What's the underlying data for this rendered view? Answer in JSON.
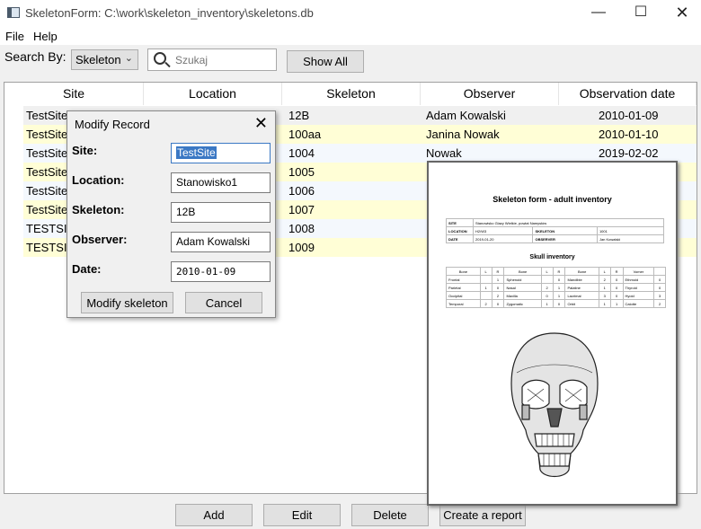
{
  "window": {
    "title": "SkeletonForm: C:\\work\\skeleton_inventory\\skeletons.db"
  },
  "menu": [
    "File",
    "Help"
  ],
  "search": {
    "label": "Search By:",
    "by_value": "Skeleton",
    "placeholder": "Szukaj",
    "show_all_label": "Show All"
  },
  "table": {
    "columns": [
      "Site",
      "Location",
      "Skeleton",
      "Observer",
      "Observation date"
    ],
    "rows": [
      {
        "site": "TestSite",
        "skeleton": "12B",
        "observer": "Adam Kowalski",
        "date": "2010-01-09"
      },
      {
        "site": "TestSite",
        "skeleton": "100aa",
        "observer": "Janina Nowak",
        "date": "2010-01-10"
      },
      {
        "site": "TestSite4",
        "skeleton": "1004",
        "observer": "Nowak",
        "date": "2019-02-02"
      },
      {
        "site": "TestSite5",
        "skeleton": "1005",
        "observer": "",
        "date": ""
      },
      {
        "site": "TestSite5",
        "skeleton": "1006",
        "observer": "",
        "date": ""
      },
      {
        "site": "TestSite5",
        "skeleton": "1007",
        "observer": "",
        "date": ""
      },
      {
        "site": "TESTSITE",
        "skeleton": "1008",
        "observer": "",
        "date": ""
      },
      {
        "site": "TESTSITE",
        "skeleton": "1009",
        "observer": "",
        "date": ""
      }
    ]
  },
  "dialog": {
    "title": "Modify Record",
    "site_label": "Site:",
    "site_value": "TestSite",
    "location_label": "Location:",
    "location_value": "Stanowisko1",
    "skeleton_label": "Skeleton:",
    "skeleton_value": "12B",
    "observer_label": "Observer:",
    "observer_value": "Adam Kowalski",
    "date_label": "Date:",
    "date_value": "2010-01-09",
    "modify_label": "Modify skeleton",
    "cancel_label": "Cancel"
  },
  "report": {
    "title": "Skeleton form - adult inventory",
    "site_label": "SITE",
    "site_value": "Stanowisko Glazy Wielkie, powiat Namysłów",
    "location_label": "LOCATION",
    "location_value": "H2/W3",
    "skeleton_label": "SKELETON",
    "skeleton_value": "1001",
    "date_label": "DATE",
    "date_value": "2019-01-20",
    "observer_label": "OBSERVER",
    "observer_value": "Jan Kowalski",
    "skull_title": "Skull inventory",
    "grid_headers": [
      "Bone",
      "L",
      "R",
      "Bone",
      "L",
      "R",
      "Bone",
      "L",
      "R",
      "Vomer",
      ""
    ],
    "grid_rows": [
      [
        "Frontal",
        "",
        "1",
        "Sphenoid",
        "",
        "0",
        "Mandible",
        "2",
        "0",
        "Ethmoid",
        "0"
      ],
      [
        "Parietal",
        "1",
        "0",
        "Nasal",
        "2",
        "1",
        "Palatine",
        "1",
        "0",
        "Thyroid",
        "0"
      ],
      [
        "Occipital",
        "",
        "2",
        "Maxilla",
        "0",
        "1",
        "Lacrimal",
        "3",
        "0",
        "Hyoid",
        "3"
      ],
      [
        "Temporal",
        "2",
        "0",
        "Zygomatic",
        "1",
        "0",
        "Orbit",
        "1",
        "1",
        "Calotte",
        "2"
      ]
    ]
  },
  "actions": {
    "add": "Add",
    "edit": "Edit",
    "delete": "Delete",
    "report": "Create a report"
  }
}
